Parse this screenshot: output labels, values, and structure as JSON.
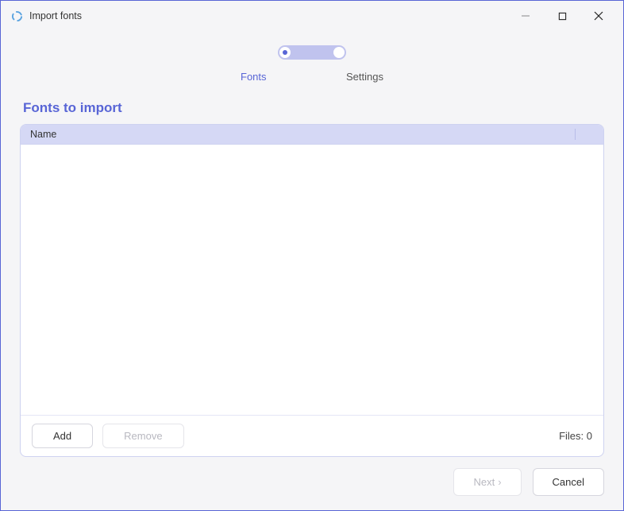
{
  "window": {
    "title": "Import fonts"
  },
  "tabs": {
    "fonts": "Fonts",
    "settings": "Settings"
  },
  "section": {
    "heading": "Fonts to import"
  },
  "table": {
    "column_name": "Name"
  },
  "actions": {
    "add": "Add",
    "remove": "Remove",
    "files_label": "Files: 0"
  },
  "footer": {
    "next": "Next",
    "cancel": "Cancel"
  }
}
